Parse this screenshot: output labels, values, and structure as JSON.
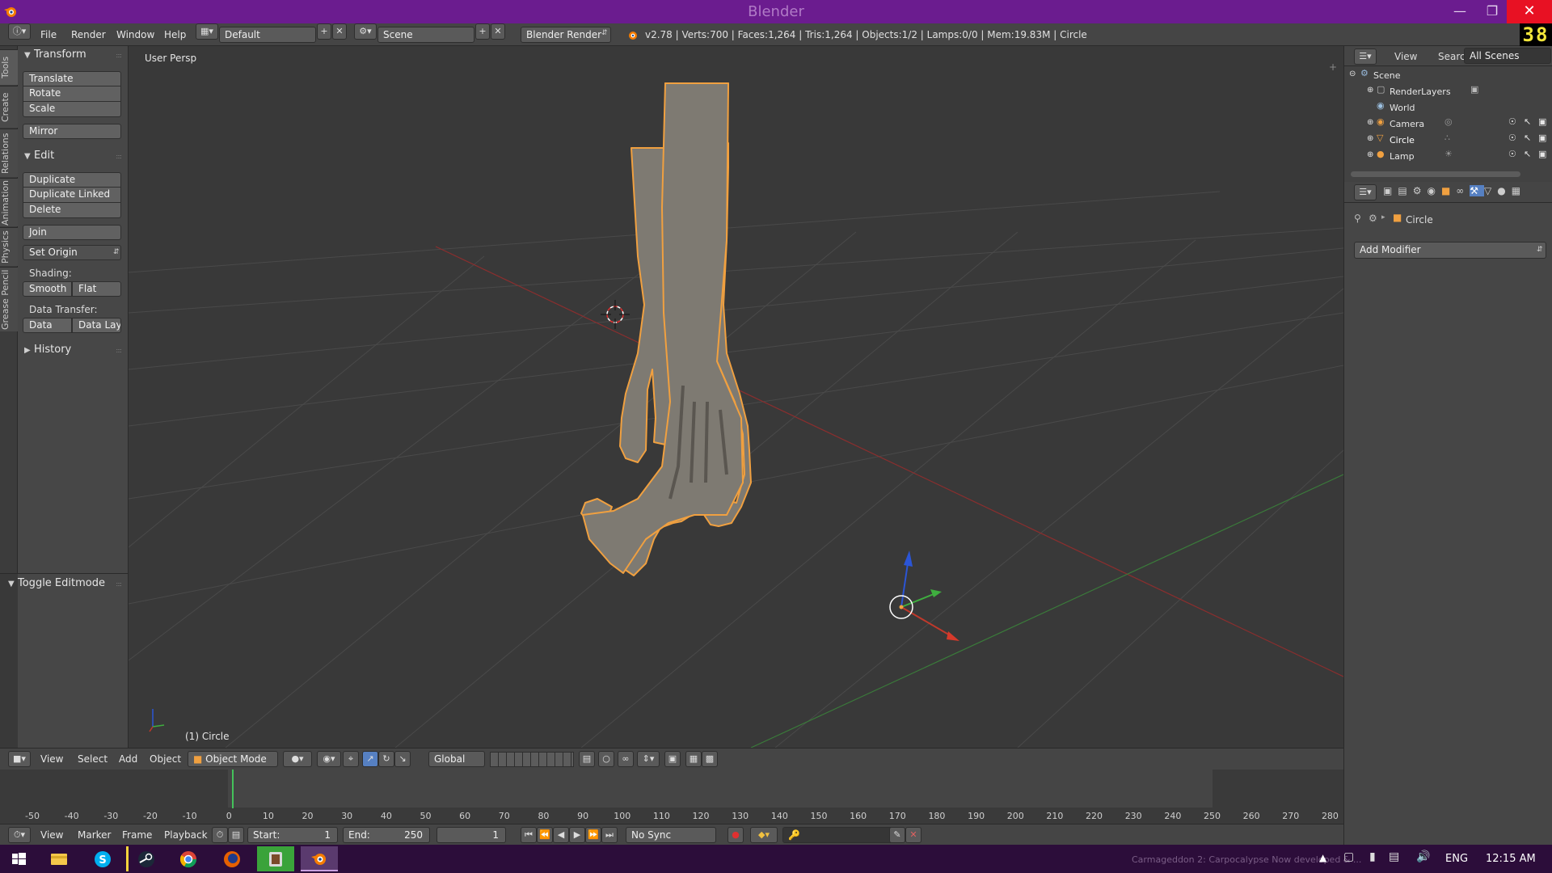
{
  "app": {
    "title": "Blender",
    "counter": "38"
  },
  "menubar": {
    "items": [
      "File",
      "Render",
      "Window",
      "Help"
    ],
    "screen_layout": "Default",
    "scene": "Scene",
    "render_engine": "Blender Render",
    "stats": "v2.78 | Verts:700 | Faces:1,264 | Tris:1,264 | Objects:1/2 | Lamps:0/0 | Mem:19.83M | Circle"
  },
  "vtabs": [
    "Tools",
    "Create",
    "Relations",
    "Animation",
    "Physics",
    "Grease Pencil"
  ],
  "toolshelf": {
    "transform": {
      "title": "Transform",
      "buttons": [
        "Translate",
        "Rotate",
        "Scale"
      ],
      "mirror": "Mirror"
    },
    "edit": {
      "title": "Edit",
      "buttons": [
        "Duplicate",
        "Duplicate Linked",
        "Delete"
      ],
      "join": "Join",
      "set_origin": "Set Origin",
      "shading_label": "Shading:",
      "smooth": "Smooth",
      "flat": "Flat",
      "data_transfer_label": "Data Transfer:",
      "data": "Data",
      "data_layout": "Data Layo"
    },
    "history": "History",
    "operator": "Toggle Editmode"
  },
  "viewport": {
    "view_name": "User Persp",
    "active_object": "(1) Circle"
  },
  "outliner": {
    "view": "View",
    "search": "Search",
    "display": "All Scenes",
    "items": [
      "Scene",
      "RenderLayers",
      "World",
      "Camera",
      "Circle",
      "Lamp"
    ]
  },
  "properties": {
    "context": "Circle",
    "add_modifier": "Add Modifier"
  },
  "view3d_header": {
    "menus": [
      "View",
      "Select",
      "Add",
      "Object"
    ],
    "mode": "Object Mode",
    "orientation": "Global"
  },
  "timeline": {
    "ticks": [
      "-50",
      "-40",
      "-30",
      "-20",
      "-10",
      "0",
      "10",
      "20",
      "30",
      "40",
      "50",
      "60",
      "70",
      "80",
      "90",
      "100",
      "110",
      "120",
      "130",
      "140",
      "150",
      "160",
      "170",
      "180",
      "190",
      "200",
      "210",
      "220",
      "230",
      "240",
      "250",
      "260",
      "270",
      "280"
    ],
    "menus": [
      "View",
      "Marker",
      "Frame",
      "Playback"
    ],
    "start_label": "Start:",
    "start_value": "1",
    "end_label": "End:",
    "end_value": "250",
    "current": "1",
    "sync": "No Sync"
  },
  "taskbar": {
    "notification": "Carmageddon 2: Carpocalypse Now developed & ...",
    "lang": "ENG",
    "time": "12:15 AM"
  },
  "colors": {
    "titlebar": "#6b1c8f",
    "taskbar": "#2c0d3a",
    "selection_outline": "#f0a040",
    "x_axis": "#c0392b",
    "y_axis": "#3fae3f",
    "z_axis": "#2b55d6"
  }
}
